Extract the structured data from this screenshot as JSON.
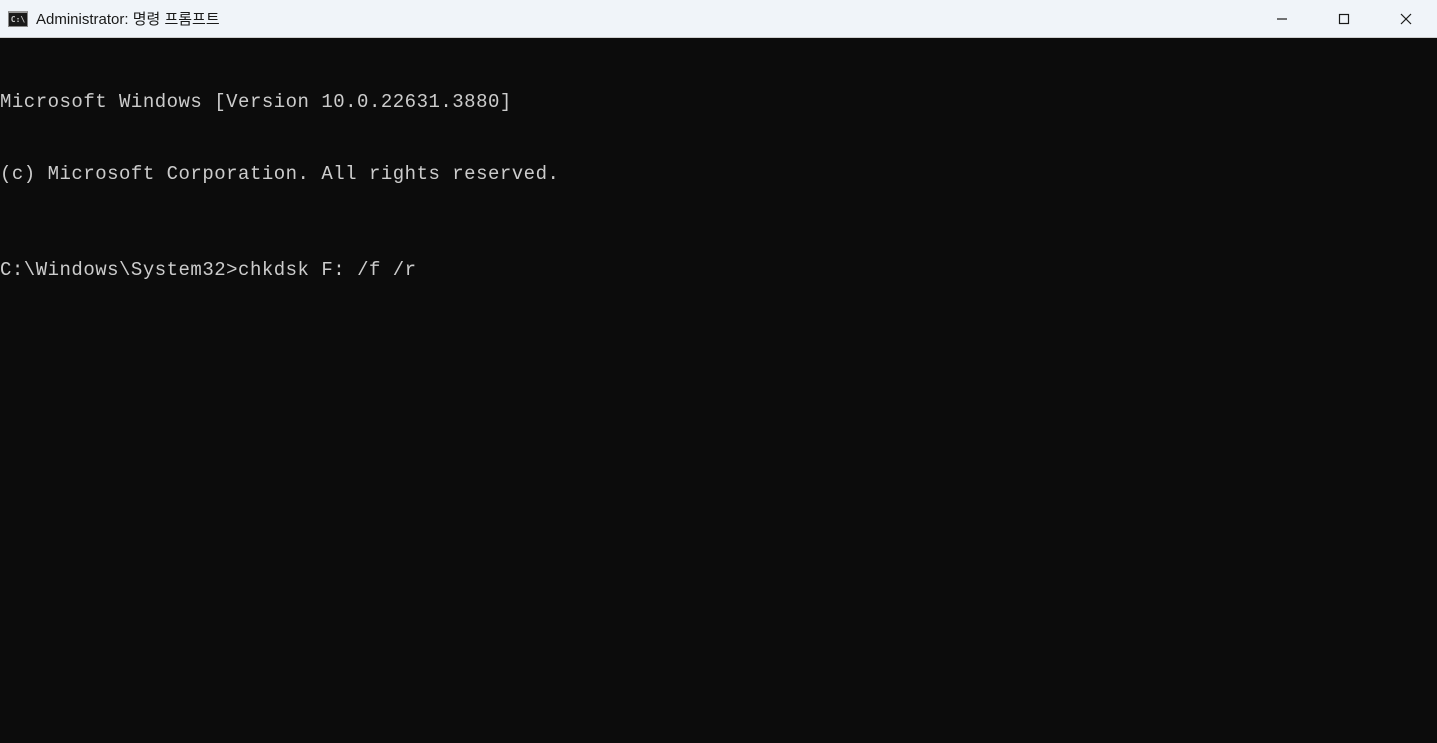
{
  "titlebar": {
    "title": "Administrator: 명령 프롬프트"
  },
  "terminal": {
    "line1": "Microsoft Windows [Version 10.0.22631.3880]",
    "line2": "(c) Microsoft Corporation. All rights reserved.",
    "prompt": "C:\\Windows\\System32>",
    "command": "chkdsk F: /f /r"
  }
}
